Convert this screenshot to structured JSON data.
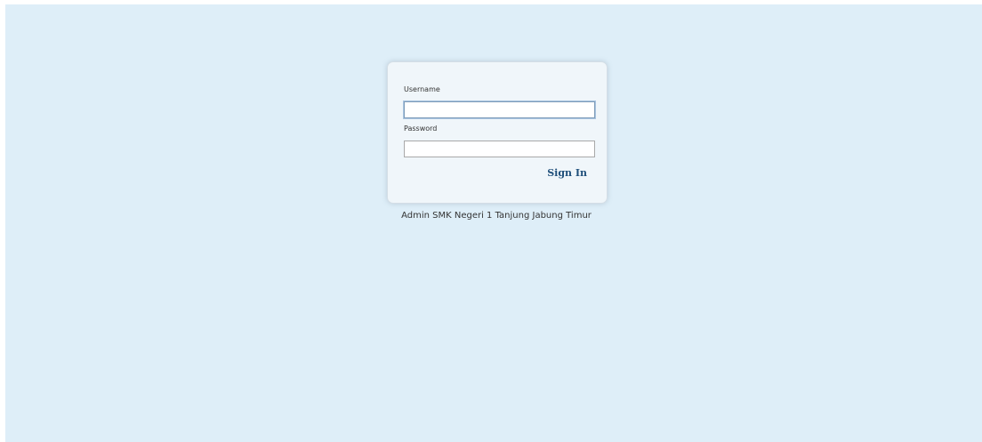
{
  "login": {
    "username_label": "Username",
    "username_value": "",
    "password_label": "Password",
    "password_value": "",
    "signin_label": "Sign In"
  },
  "footer": {
    "text": "Admin SMK Negeri 1 Tanjung Jabung Timur"
  },
  "colors": {
    "background": "#deeef8",
    "panel": "#f0f6fa",
    "accent": "#1f4f7a"
  }
}
